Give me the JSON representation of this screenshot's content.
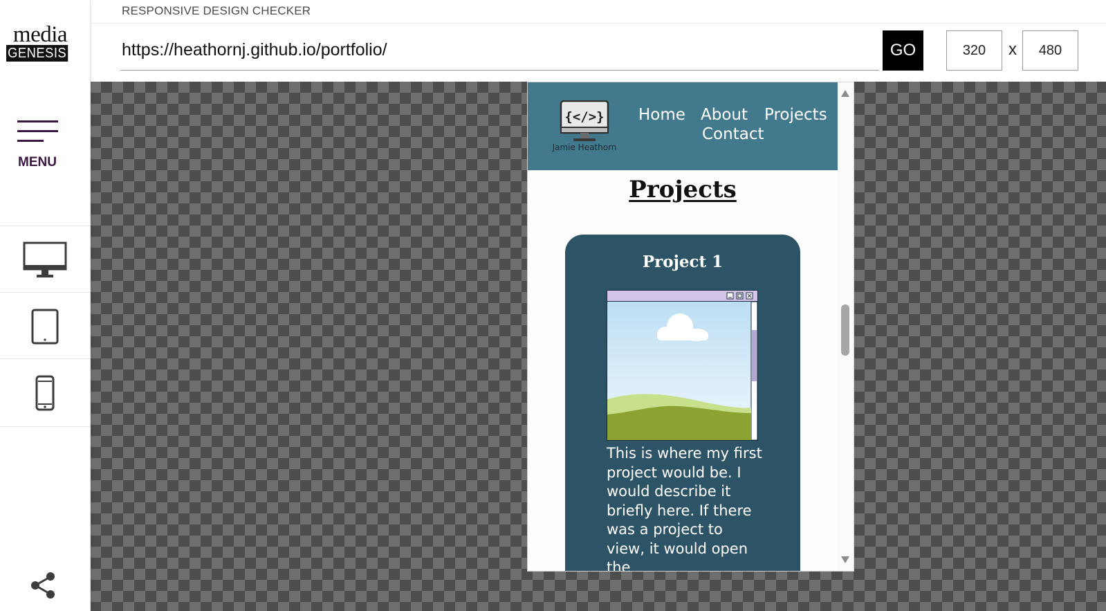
{
  "app": {
    "title": "RESPONSIVE DESIGN CHECKER",
    "logo_top": "media",
    "logo_bottom": "GENESIS"
  },
  "sidebar": {
    "menu_label": "MENU",
    "devices": [
      "desktop-icon",
      "tablet-icon",
      "phone-icon"
    ],
    "share_icon": "share-icon"
  },
  "toolbar": {
    "url": "https://heathornj.github.io/portfolio/",
    "go_label": "GO",
    "width": "320",
    "height": "480",
    "separator": "x"
  },
  "site": {
    "logo_code": "{</>}",
    "owner_name": "Jamie Heathorn",
    "nav": [
      "Home",
      "About",
      "Projects",
      "Contact"
    ],
    "heading": "Projects",
    "project": {
      "title": "Project 1",
      "description": "This is where my first project would be. I would describe it briefly here. If there was a project to view, it would open the"
    }
  },
  "colors": {
    "accent_menu": "#3a1740",
    "site_header": "#43798c",
    "card_bg": "#2d5466",
    "go_button": "#000000"
  }
}
